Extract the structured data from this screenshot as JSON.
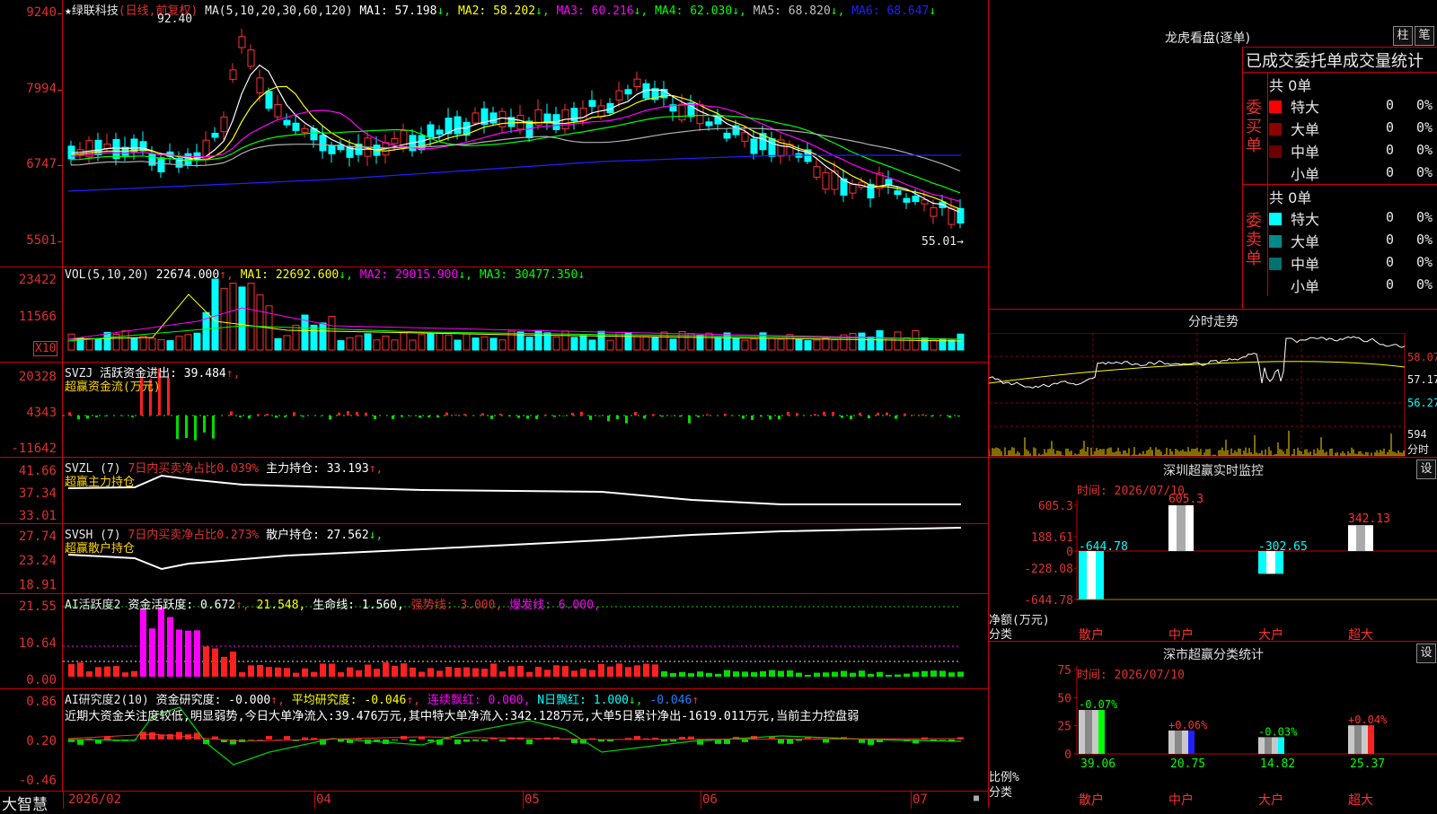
{
  "app": {
    "brand": "大智慧"
  },
  "stock": {
    "star": "★",
    "name": "绿联科技",
    "mode": "(日线,前复权)"
  },
  "main": {
    "ma_label": "MA(5,10,20,30,60,120)",
    "ma": [
      {
        "label": "MA1: 57.198",
        "arrow": "↓",
        "color": "#ffffff"
      },
      {
        "label": "MA2: 58.202",
        "arrow": "↓",
        "color": "#ffff00"
      },
      {
        "label": "MA3: 60.216",
        "arrow": "↓",
        "color": "#ff00ff"
      },
      {
        "label": "MA4: 62.030",
        "arrow": "↓",
        "color": "#00ff00"
      },
      {
        "label": "MA5: 68.820",
        "arrow": "↓",
        "color": "#c0c0c0"
      },
      {
        "label": "MA6: 68.647",
        "arrow": "↓",
        "color": "#2020ff"
      }
    ],
    "high_marker": "92.40",
    "low_marker": "55.01→",
    "yticks": [
      "9240",
      "7994",
      "6747",
      "5501"
    ]
  },
  "vol": {
    "label": "VOL(5,10,20)",
    "value": "22674.000",
    "ma1": "MA1: 22692.600",
    "ma2": "MA2: 29015.900",
    "ma3": "MA3: 30477.350",
    "yticks": [
      "23422",
      "11566"
    ],
    "unit": "X10"
  },
  "svzj": {
    "label": "SVZJ",
    "title": "活跃资金进出: 39.484",
    "subtitle": "超赢资金流(万元)",
    "yticks": [
      "20328",
      "4343",
      "-11642"
    ]
  },
  "svzl": {
    "label": "SVZL (7)",
    "desc": "7日内买卖净占比0.039%",
    "val": "主力持仓: 33.193",
    "subtitle": "超赢主力持仓",
    "yticks": [
      "41.66",
      "37.34",
      "33.01"
    ]
  },
  "svsh": {
    "label": "SVSH (7)",
    "desc": "7日内买卖净占比0.273%",
    "val": "散户持仓: 27.562",
    "subtitle": "超赢散户持仓",
    "yticks": [
      "27.74",
      "23.24",
      "18.91"
    ]
  },
  "ai1": {
    "label": "AI活跃度2",
    "v1": "资金活跃度: 0.672",
    "v2": "21.548,",
    "v3": "生命线: 1.560,",
    "v4": "强势线: 3.000,",
    "v5": "爆发线: 6.000,",
    "yticks": [
      "21.55",
      "10.64",
      "0.00"
    ]
  },
  "ai2": {
    "label": "AI研究度2(10)",
    "v1": "资金研究度: -0.000",
    "v2": "平均研究度: -0.046",
    "v3": "连续飘红: 0.000,",
    "v4": "N日飘红: 1.000",
    "v5": "-0.046",
    "text": "近期大资金关注度较低,明显弱势,今日大单净流入:39.476万元,其中特大单净流入:342.128万元,大单5日累计净出-1619.011万元,当前主力控盘弱",
    "yticks": [
      "0.86",
      "0.20",
      "-0.46"
    ]
  },
  "xaxis": [
    "2026/02",
    "04",
    "05",
    "06",
    "07"
  ],
  "lhb": {
    "title": "龙虎看盘(逐单)",
    "btn1": "柱",
    "btn2": "笔",
    "heading": "已成交委托单成交量统计",
    "buy_side": "委买单",
    "sell_side": "委卖单",
    "buy_total": "共 0单",
    "sell_total": "共 0单",
    "buy_rows": [
      {
        "name": "特大",
        "count": "0",
        "pct": "0%",
        "color": "#ff0000"
      },
      {
        "name": "大单",
        "count": "0",
        "pct": "0%",
        "color": "#8b0000"
      },
      {
        "name": "中单",
        "count": "0",
        "pct": "0%",
        "color": "#6b0000"
      },
      {
        "name": "小单",
        "count": "0",
        "pct": "0%",
        "color": ""
      }
    ],
    "sell_rows": [
      {
        "name": "特大",
        "count": "0",
        "pct": "0%",
        "color": "#00ffff"
      },
      {
        "name": "大单",
        "count": "0",
        "pct": "0%",
        "color": "#008b8b"
      },
      {
        "name": "中单",
        "count": "0",
        "pct": "0%",
        "color": "#007070"
      },
      {
        "name": "小单",
        "count": "0",
        "pct": "0%",
        "color": ""
      }
    ]
  },
  "fenshi": {
    "title": "分时走势",
    "yticks": [
      "58.07",
      "57.17",
      "56.27"
    ],
    "vol_label": "594",
    "vol_unit": "分时"
  },
  "sz_monitor": {
    "title": "深圳超赢实时监控",
    "btn": "设",
    "time": "时间: 2026/07/10",
    "yticks": [
      "605.3",
      "188.61",
      "0",
      "-228.08",
      "-644.78"
    ],
    "ylabel": "净额(万元)",
    "xlabel": "分类",
    "categories": [
      "散户",
      "中户",
      "大户",
      "超大"
    ],
    "values": [
      -644.78,
      605.3,
      -302.65,
      342.13
    ],
    "value_labels": [
      "-644.78",
      "605.3",
      "-302.65",
      "342.13"
    ]
  },
  "sz_class": {
    "title": "深市超赢分类统计",
    "btn": "设",
    "time": "时间: 2026/07/10",
    "yticks": [
      "75",
      "50",
      "25",
      "0"
    ],
    "ylabel": "比例%",
    "xlabel": "分类",
    "categories": [
      "散户",
      "中户",
      "大户",
      "超大"
    ],
    "values": [
      39.06,
      20.75,
      14.82,
      25.37
    ],
    "value_labels": [
      "39.06",
      "20.75",
      "14.82",
      "25.37"
    ],
    "changes": [
      "-0.07%",
      "+0.06%",
      "-0.03%",
      "+0.04%"
    ]
  },
  "chart_data": [
    {
      "type": "bar",
      "title": "深圳超赢实时监控",
      "categories": [
        "散户",
        "中户",
        "大户",
        "超大"
      ],
      "values": [
        -644.78,
        605.3,
        -302.65,
        342.13
      ],
      "ylabel": "净额(万元)",
      "xlabel": "分类",
      "ylim": [
        -644.78,
        605.3
      ]
    },
    {
      "type": "bar",
      "title": "深市超赢分类统计",
      "categories": [
        "散户",
        "中户",
        "大户",
        "超大"
      ],
      "values": [
        39.06,
        20.75,
        14.82,
        25.37
      ],
      "ylabel": "比例%",
      "xlabel": "分类",
      "ylim": [
        0,
        75
      ]
    }
  ]
}
